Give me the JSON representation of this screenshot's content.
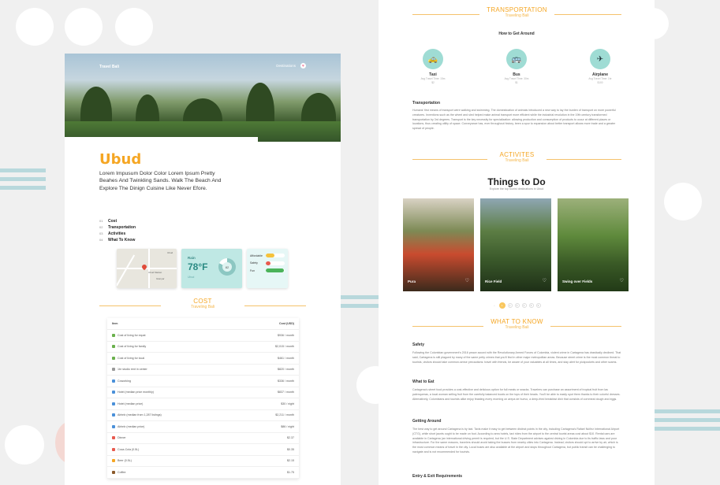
{
  "left": {
    "brand": "Travel Bali",
    "nav_destinations": "Destinations",
    "city": "Ubud",
    "lead": "Lorem Impusum Dolor Color Lorem Ipsum Pretty Beahes And Twinkling Sands. Walk The Beach And Explore The Dinign Cuisine Like Never Efore.",
    "toc": [
      {
        "n": "01",
        "t": "Cost"
      },
      {
        "n": "02",
        "t": "Transportation"
      },
      {
        "n": "03",
        "t": "Activities"
      },
      {
        "n": "04",
        "t": "What To Know"
      }
    ],
    "map": {
      "label_a": "Ubud",
      "label_b": "Gianyar",
      "label_c": "Ubud Market"
    },
    "weather": {
      "label": "Rain",
      "temp": "78°F",
      "place": "Ubud",
      "dial": "82"
    },
    "meters": [
      {
        "label": "Affordable",
        "color": "#f5c23c",
        "value": 0.45
      },
      {
        "label": "Safety",
        "color": "#e85a4f",
        "value": 0.25
      },
      {
        "label": "Fun",
        "color": "#4bb35a",
        "value": 0.95
      }
    ],
    "cost_head": {
      "title": "COST",
      "subtitle": "Traveling Bali"
    },
    "cost_table": {
      "col_item": "Item",
      "col_cost": "Cost (USD)",
      "rows": [
        {
          "icon": "#6ab04c",
          "item": "Cost of living for expat",
          "cost": "$936 / month"
        },
        {
          "icon": "#6ab04c",
          "item": "Cost of living for family",
          "cost": "$2,015 / month"
        },
        {
          "icon": "#6ab04c",
          "item": "Cost of living for local",
          "cost": "$461 / month"
        },
        {
          "icon": "#999999",
          "item": "1br studio rent in center",
          "cost": "$820 / month"
        },
        {
          "icon": "#4a90d9",
          "item": "Coworking",
          "cost": "$336 / month"
        },
        {
          "icon": "#4a90d9",
          "item": "Hotel (median price monthly)",
          "cost": "$837 / month"
        },
        {
          "icon": "#4a90d9",
          "item": "Hotel (median price)",
          "cost": "$30 / night"
        },
        {
          "icon": "#4a90d9",
          "item": "Airbnb (median from 1,287 listings)",
          "cost": "$2,211 / month"
        },
        {
          "icon": "#4a90d9",
          "item": "Airbnb (median price)",
          "cost": "$86 / night"
        },
        {
          "icon": "#e85a4f",
          "item": "Dinner",
          "cost": "$2.37"
        },
        {
          "icon": "#e85a4f",
          "item": "Coca-Cola (0.5L)",
          "cost": "$0.35"
        },
        {
          "icon": "#f5a623",
          "item": "Beer (0.5L)",
          "cost": "$2.15"
        },
        {
          "icon": "#8b5a2b",
          "item": "Coffee",
          "cost": "$1.75"
        }
      ]
    }
  },
  "right": {
    "transport_head": {
      "title": "TRANSPORTATION",
      "subtitle": "Traveling Bali"
    },
    "how_title": "How to Get Around",
    "modes": [
      {
        "name": "Taxi",
        "sub1": "Avg Travel Time: 15m",
        "sub2": "$2",
        "icon": "taxi-icon",
        "glyph": "🚕"
      },
      {
        "name": "Bus",
        "sub1": "Avg Travel Time: 30m",
        "sub2": "$1",
        "icon": "bus-icon",
        "glyph": "🚌"
      },
      {
        "name": "Airplane",
        "sub1": "Avg Travel Time: 1hr",
        "sub2": "$100",
        "icon": "airplane-icon",
        "glyph": "✈"
      }
    ],
    "transport_title": "Transportation",
    "transport_text": "Humans' first means of transport were walking and swimming. The domestication of animals introduced a new way to lay the burden of transport on more powerful creatures. Inventions such as the wheel and sled helped make animal transport more efficient while the industrial revolution in the 19th century transformed transportation by 3rd degrees. Transport is the key necessity for specialization: allowing production and consumption of products to occur at different places or locations, thus creating utility of space. Conveyance has, ever throughout history, been a spur to expansion about better transport allows more trade and a greater spread of people.",
    "activities_head": {
      "title": "ACTIVITES",
      "subtitle": "Traveling Bali"
    },
    "ttd_title": "Things to Do",
    "ttd_sub": "Explore the top tourist destinations in Ubud",
    "photos": [
      {
        "caption": "Pura",
        "bg": "linear-gradient(180deg,#d9d2c4 0%,#7d8a55 35%,#c94b2f 60%,#3b2a1c 100%)"
      },
      {
        "caption": "Rice Field",
        "bg": "linear-gradient(180deg,#8fa7b3 0%,#5c7d44 35%,#3b5a2b 65%,#1e2f17 100%)"
      },
      {
        "caption": "Swing over Fields",
        "bg": "linear-gradient(180deg,#9cb07a 0%,#5f8a3c 40%,#3a5a26 70%,#223a17 100%)"
      }
    ],
    "pager": [
      "1",
      "2",
      "3",
      "4",
      "5",
      "6"
    ],
    "know_head": {
      "title": "WHAT TO KNOW",
      "subtitle": "Traveling Bali"
    },
    "know": [
      {
        "title": "Safety",
        "text": "Following the Colombian government's 2016 peace accord with the Revolutionary Armed Forces of Colombia, violent crime in Cartagena has drastically declined. That said, Cartagena is still plagued by many of the same petty crimes that you'll find in other major metropolitan areas. Because street crime is the most common threat to tourists, visitors should take common-sense precautions: travel with friends, be aware of your valuables at all times, and stay alert for pickpockets and other scams."
      },
      {
        "title": "What to Eat",
        "text": "Cartagena's street food provides a cost-effective and delicious option for full meals or snacks. Travelers can purchase an assortment of tropical fruit from las palenqueras, a local woman selling fruit from the carefully balanced bowls on the tops of their heads. You'll be able to easily spot them thanks to their colorful dresses. Alternatively, Colombians and tourists alike enjoy feasting every morning on arepa de huevo, a deep-fried breakfast dish that consists of cornmeal dough and eggs."
      },
      {
        "title": "Getting Around",
        "text": "The best way to get around Cartagena is by taxi. Taxis make it easy to get between distinct points in the city, including Cartagena's Rafael Núñez International Airport (CTG), while short jaunts ought to be made on foot. According to area hotels, taxi rides from the airport to the central tourist areas cost about $10. Rental cars are available in Cartagena (an international driving permit is required, but the U.S. State Department advises against driving in Colombia due to its traffic laws and poor infrastructure. For the same reasons, travelers should avoid taking the busses from nearby cities into Cartagena. Instead, visitors should opt to arrive by air, which is the most common means of travel in the city. Local buses are also available at the airport and stops throughout Cartagena, but public transit can be challenging to navigate and is not recommended for tourists."
      },
      {
        "title": "Entry & Exit Requirements",
        "text": ""
      }
    ]
  }
}
